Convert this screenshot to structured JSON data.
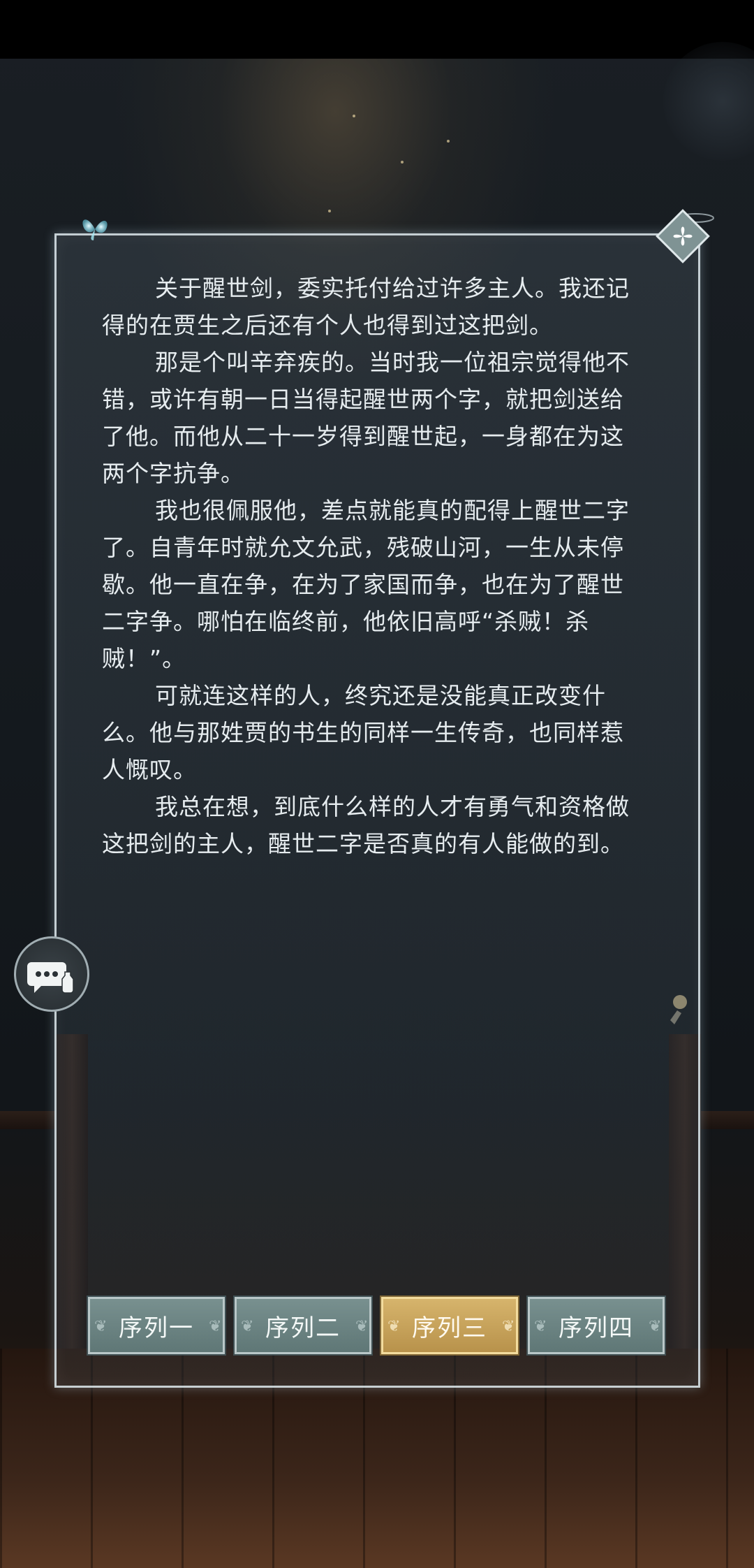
{
  "letter": {
    "paragraphs": [
      "关于醒世剑，委实托付给过许多主人。我还记得的在贾生之后还有个人也得到过这把剑。",
      "那是个叫辛弃疾的。当时我一位祖宗觉得他不错，或许有朝一日当得起醒世两个字，就把剑送给了他。而他从二十一岁得到醒世起，一身都在为这两个字抗争。",
      "我也很佩服他，差点就能真的配得上醒世二字了。自青年时就允文允武，残破山河，一生从未停歇。他一直在争，在为了家国而争，也在为了醒世二字争。哪怕在临终前，他依旧高呼“杀贼！杀贼！”。",
      "可就连这样的人，终究还是没能真正改变什么。他与那姓贾的书生的同样一生传奇，也同样惹人慨叹。",
      "我总在想，到底什么样的人才有勇气和资格做这把剑的主人，醒世二字是否真的有人能做的到。"
    ]
  },
  "tabs": [
    {
      "label": "序列一",
      "active": false
    },
    {
      "label": "序列二",
      "active": false
    },
    {
      "label": "序列三",
      "active": true
    },
    {
      "label": "序列四",
      "active": false
    }
  ],
  "icons": {
    "close": "close-icon",
    "chat": "chat-bubble-icon",
    "butterfly": "butterfly-icon"
  },
  "colors": {
    "active_tab": "#c9a55c",
    "inactive_tab": "#6c8483",
    "text": "#e6ecef"
  }
}
